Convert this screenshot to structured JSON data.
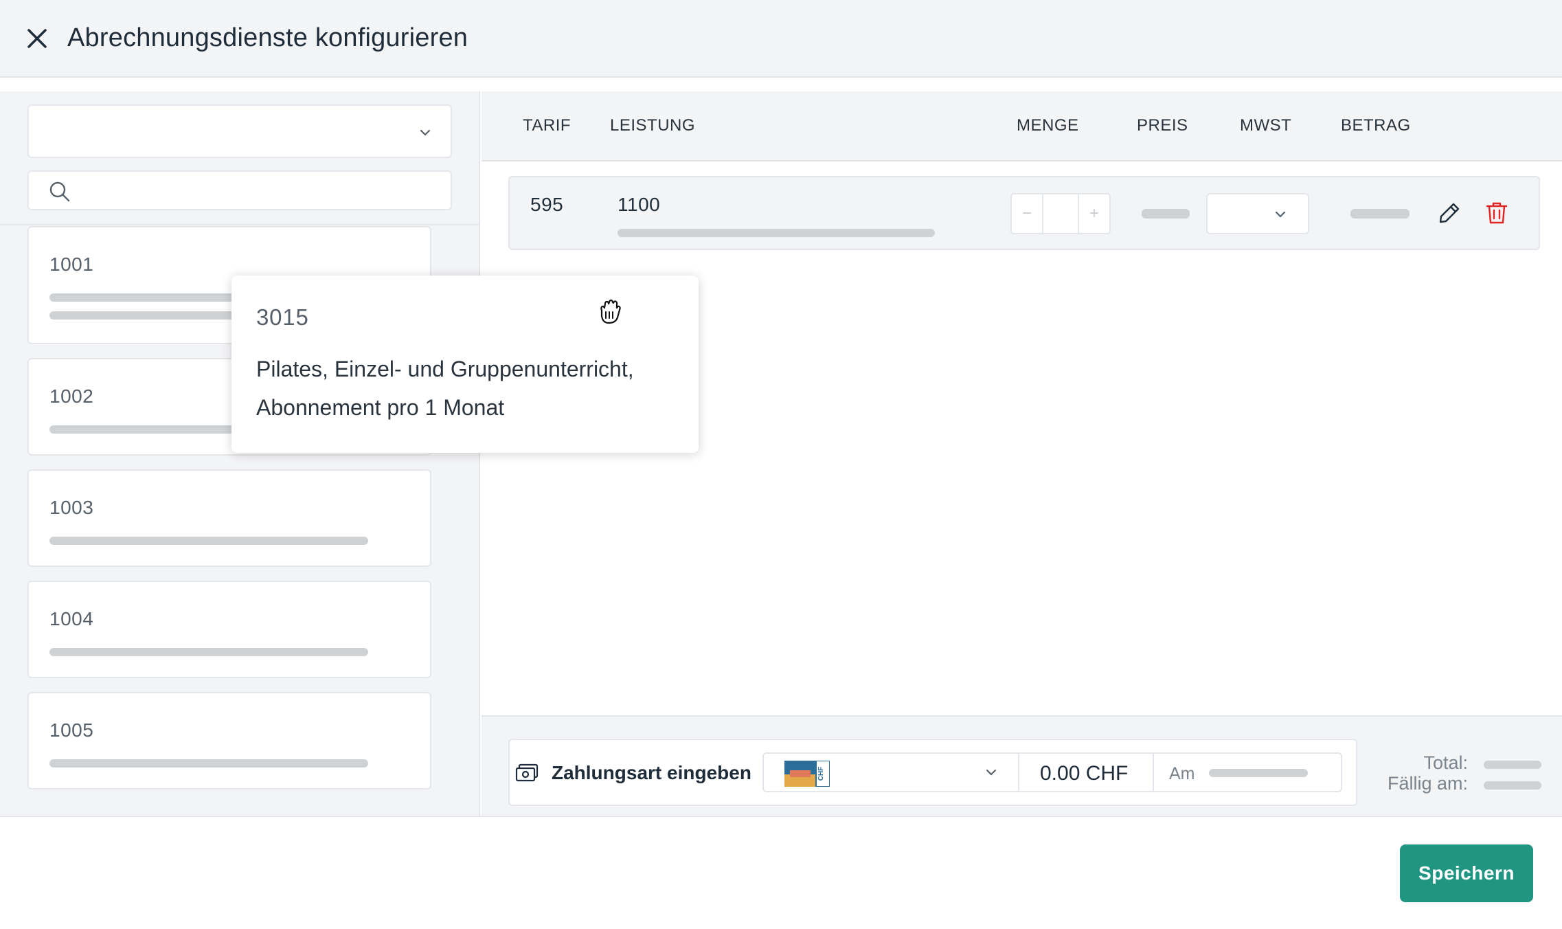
{
  "header": {
    "title": "Abrechnungsdienste konfigurieren"
  },
  "sidebar": {
    "select_value": "",
    "search_placeholder": "",
    "cards": [
      {
        "code": "1001"
      },
      {
        "code": "1002"
      },
      {
        "code": "1003"
      },
      {
        "code": "1004"
      },
      {
        "code": "1005"
      }
    ]
  },
  "tooltip": {
    "code": "3015",
    "description": "Pilates, Einzel- und Gruppenunterricht, Abonnement pro 1 Monat"
  },
  "table": {
    "columns": [
      "TARIF",
      "LEISTUNG",
      "MENGE",
      "PREIS",
      "MWST",
      "BETRAG"
    ],
    "rows": [
      {
        "tarif": "595",
        "leistung": "1100",
        "menge": ""
      }
    ],
    "stepper": {
      "minus": "−",
      "plus": "+"
    }
  },
  "payment": {
    "label": "Zahlungsart eingeben",
    "currency_flag_text": "CHF",
    "amount": "0.00 CHF",
    "date_prefix": "Am"
  },
  "totals": {
    "total_label": "Total:",
    "due_label": "Fällig am:"
  },
  "footer": {
    "save_label": "Speichern"
  },
  "colors": {
    "accent": "#1f9582",
    "danger": "#e02424",
    "placeholder_bar": "#cfd2d5"
  }
}
